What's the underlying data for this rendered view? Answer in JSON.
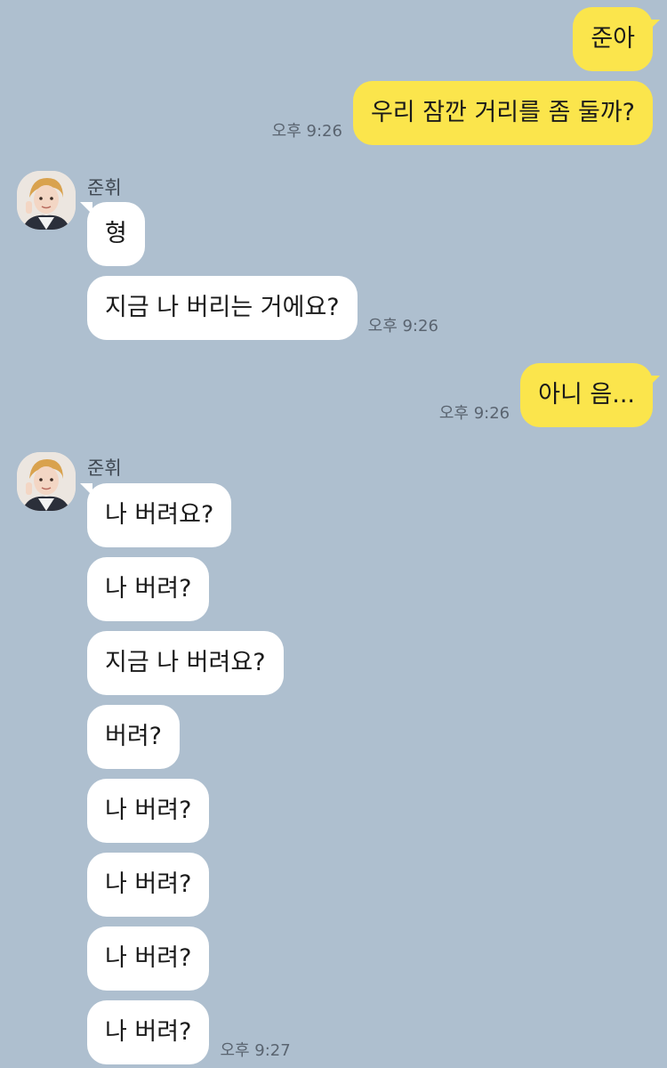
{
  "colors": {
    "background": "#aebfcf",
    "my_bubble": "#fbe54c",
    "their_bubble": "#ffffff"
  },
  "icons": {
    "avatar": "profile-photo"
  },
  "messages": [
    {
      "from": "me",
      "text": "준아"
    },
    {
      "from": "me",
      "text": "우리 잠깐 거리를 좀 둘까?",
      "time": "오후 9:26"
    },
    {
      "from": "them",
      "sender": "준휘",
      "text": "형"
    },
    {
      "from": "them",
      "text": "지금 나 버리는 거에요?",
      "time": "오후 9:26"
    },
    {
      "from": "me",
      "text": "아니 음...",
      "time": "오후 9:26"
    },
    {
      "from": "them",
      "sender": "준휘",
      "text": "나 버려요?"
    },
    {
      "from": "them",
      "text": "나 버려?"
    },
    {
      "from": "them",
      "text": "지금 나 버려요?"
    },
    {
      "from": "them",
      "text": "버려?"
    },
    {
      "from": "them",
      "text": "나 버려?"
    },
    {
      "from": "them",
      "text": "나 버려?"
    },
    {
      "from": "them",
      "text": "나 버려?"
    },
    {
      "from": "them",
      "text": "나 버려?",
      "time": "오후 9:27"
    }
  ]
}
